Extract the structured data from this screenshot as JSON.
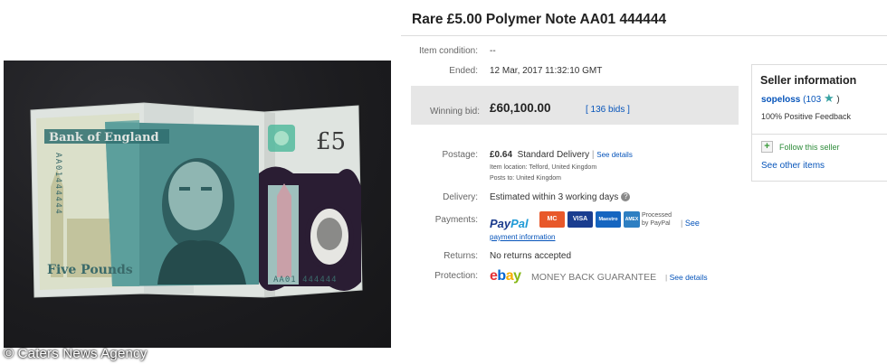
{
  "listing": {
    "title": "Rare £5.00 Polymer Note AA01 444444",
    "item_condition_label": "Item condition:",
    "item_condition_value": "--",
    "ended_label": "Ended:",
    "ended_value": "12 Mar, 2017   11:32:10 GMT",
    "winning_bid_label": "Winning bid:",
    "winning_bid_value": "£60,100.00",
    "bids_link": "[ 136 bids ]",
    "postage_label": "Postage:",
    "postage_cost": "£0.64",
    "postage_method": "Standard Delivery",
    "postage_details_link": "See details",
    "item_location": "Item location:  Telford, United Kingdom",
    "posts_to": "Posts to:  United Kingdom",
    "delivery_label": "Delivery:",
    "delivery_value": "Estimated within 3 working days",
    "payments_label": "Payments:",
    "paypal_word_1": "Pay",
    "paypal_word_2": "Pal",
    "card_1": "MC",
    "card_2": "VISA",
    "card_3": "Maestro",
    "card_4": "AMEX",
    "processed_line_1": "Processed",
    "processed_line_2": "by PayPal",
    "payment_see": "See",
    "payment_info_link": "payment information",
    "returns_label": "Returns:",
    "returns_value": "No returns accepted",
    "protection_label": "Protection:",
    "ebay_logo": [
      "e",
      "b",
      "a",
      "y"
    ],
    "guarantee_text": "MONEY BACK GUARANTEE",
    "protection_details_link": "See details"
  },
  "seller": {
    "heading": "Seller information",
    "username": "sopeloss",
    "feedback_score": "(103",
    "feedback_close": ")",
    "positive_feedback": "100% Positive Feedback",
    "follow_label": "Follow this seller",
    "other_items_link": "See other items"
  },
  "photo": {
    "credit": "© Caters News Agency",
    "note_bank": "Bank of England",
    "note_serial": "AA01 444444",
    "note_serial_vertical": "AA01444444",
    "note_value": "£5",
    "note_words": "Five Pounds"
  },
  "colors": {
    "link": "#0654ba",
    "bid_box": "#e6e6e6",
    "note_teal": "#4f8f8e",
    "note_paper": "#dfe4e0"
  }
}
